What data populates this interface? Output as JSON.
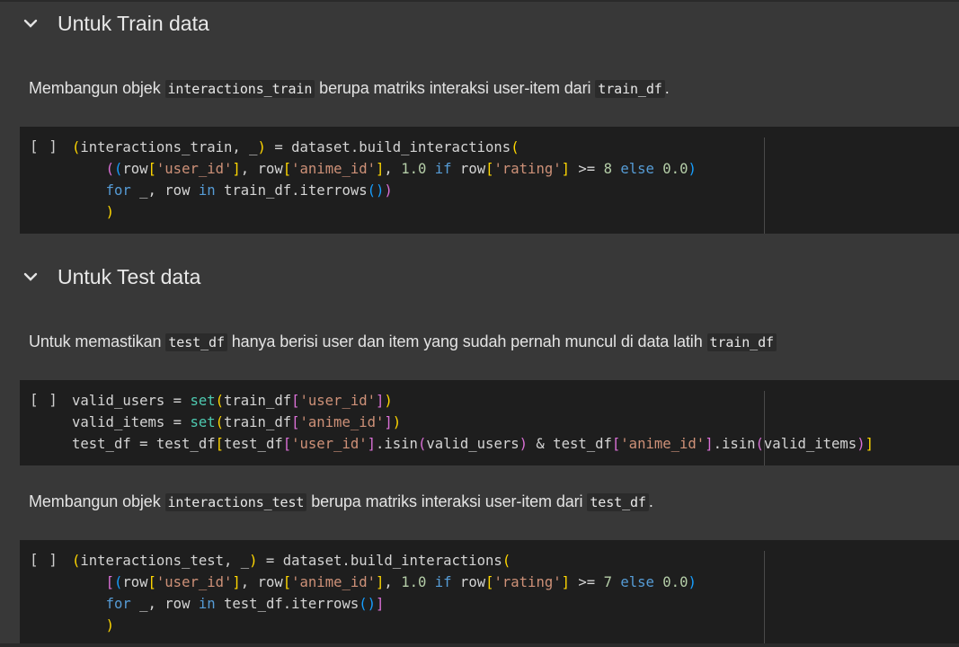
{
  "sections": [
    {
      "heading": "Untuk Train data",
      "paragraph": {
        "pre": "Membangun objek ",
        "code1": "interactions_train",
        "mid": " berupa matriks interaksi user-item dari ",
        "code2": "train_df",
        "post": "."
      },
      "cell": {
        "run_label": "[ ]",
        "lines": [
          [
            "(interactions_train, _) = dataset.build_interactions(",
            ""
          ],
          [
            "    ((row['user_id'], row['anime_id'], 1.0 if row['rating'] >= 8 else 0.0)",
            ""
          ],
          [
            "    for _, row in train_df.iterrows())",
            ""
          ],
          [
            "    )",
            ""
          ]
        ]
      }
    },
    {
      "heading": "Untuk Test data",
      "paragraph": {
        "pre": "Untuk memastikan ",
        "code1": "test_df",
        "mid": " hanya berisi user dan item yang sudah pernah muncul di data latih ",
        "code2": "train_df",
        "post": ""
      },
      "cell": {
        "run_label": "[ ]",
        "lines": [
          [
            "valid_users = set(train_df['user_id'])",
            ""
          ],
          [
            "valid_items = set(train_df['anime_id'])",
            ""
          ],
          [
            "test_df = test_df[test_df['user_id'].isin(valid_users) & test_df['anime_id'].isin(valid_items)]",
            ""
          ]
        ]
      }
    },
    {
      "paragraph": {
        "pre": "Membangun objek ",
        "code1": "interactions_test",
        "mid": " berupa matriks interaksi user-item dari ",
        "code2": "test_df",
        "post": "."
      },
      "cell": {
        "run_label": "[ ]",
        "lines": [
          [
            "(interactions_test, _) = dataset.build_interactions(",
            ""
          ],
          [
            "    [(row['user_id'], row['anime_id'], 1.0 if row['rating'] >= 7 else 0.0)",
            ""
          ],
          [
            "    for _, row in test_df.iterrows()]",
            ""
          ],
          [
            "    )",
            ""
          ]
        ]
      }
    }
  ],
  "icons": {
    "collapse": "chevron-down-icon"
  },
  "colors": {
    "background": "#383838",
    "cell_background": "#1e1e1e",
    "keyword": "#569cd6",
    "string": "#ce9178",
    "number": "#b5cea8",
    "builtin": "#4ec9b0"
  }
}
